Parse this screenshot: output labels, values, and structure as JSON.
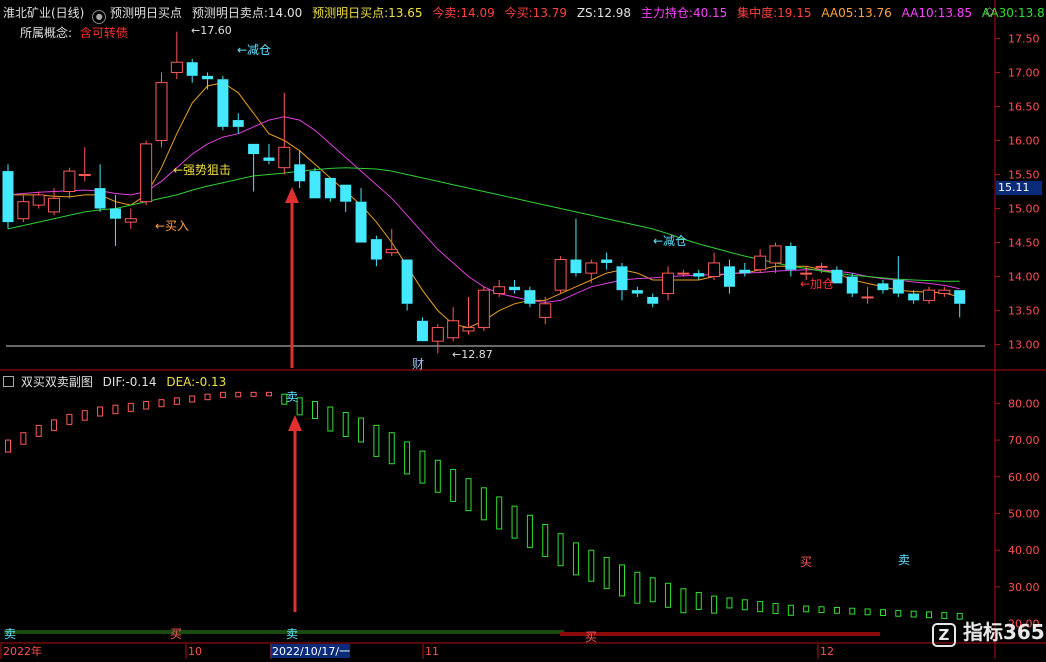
{
  "colors": {
    "up": "#ff5a5a",
    "down": "#44e8ff",
    "ma5": "#e8a020",
    "ma10": "#e040e0",
    "ma30": "#30d030",
    "frame": "#b01010",
    "axis_text": "#ff5050",
    "white": "#e0e0e0",
    "yellow": "#f0e040",
    "cyan": "#60e0ff",
    "magenta": "#ff40ff",
    "red": "#ff3030",
    "green": "#30e030",
    "orange": "#ffa040"
  },
  "header": {
    "stock": "淮北矿业(日线)",
    "indicator_icon": "gear-icon",
    "indicator": "预测明日买点",
    "sell_label": "预测明日卖点:",
    "sell_value": "14.00",
    "buy_label": "预测明日买点:",
    "buy_value": "13.65",
    "today_sell_label": "今卖:",
    "today_sell_value": "14.09",
    "today_buy_label": "今买:",
    "today_buy_value": "13.79",
    "zs_label": "ZS:",
    "zs_value": "12.98",
    "main_hold_label": "主力持仓:",
    "main_hold_value": "40.15",
    "conc_label": "集中度:",
    "conc_value": "19.15",
    "aa05_label": "AA05:",
    "aa05_value": "13.76",
    "aa10_label": "AA10:",
    "aa10_value": "13.85",
    "aa30_label": "AA30:",
    "aa30_value": "13.8",
    "concept_label": "所属概念:",
    "concept_value": "含可转债"
  },
  "sub_header": {
    "name": "双买双卖副图",
    "dif_label": "DIF:",
    "dif_value": "-0.14",
    "dea_label": "DEA:",
    "dea_value": "-0.13"
  },
  "price_label": "15.11",
  "x_labels": [
    "2022年",
    "10",
    "2022/10/17/一",
    "11",
    "12"
  ],
  "watermark": "指标365",
  "watermark_icon": "z-logo-icon",
  "chart_data": [
    {
      "type": "candlestick",
      "ylim": [
        12.7,
        17.8
      ],
      "yticks": [
        "17.50",
        "17.00",
        "16.50",
        "16.00",
        "15.50",
        "15.00",
        "14.50",
        "14.00",
        "13.50",
        "13.00"
      ],
      "ytick_values": [
        17.5,
        17.0,
        16.5,
        16.0,
        15.5,
        15.0,
        14.5,
        14.0,
        13.5,
        13.0
      ],
      "candles": [
        {
          "o": 15.55,
          "h": 15.65,
          "l": 14.7,
          "c": 14.8
        },
        {
          "o": 14.85,
          "h": 15.2,
          "l": 14.8,
          "c": 15.1
        },
        {
          "o": 15.05,
          "h": 15.25,
          "l": 15.0,
          "c": 15.2
        },
        {
          "o": 14.95,
          "h": 15.3,
          "l": 14.9,
          "c": 15.15
        },
        {
          "o": 15.25,
          "h": 15.6,
          "l": 15.15,
          "c": 15.55
        },
        {
          "o": 15.5,
          "h": 15.9,
          "l": 15.4,
          "c": 15.5
        },
        {
          "o": 15.3,
          "h": 15.65,
          "l": 14.95,
          "c": 15.0
        },
        {
          "o": 15.0,
          "h": 15.2,
          "l": 14.45,
          "c": 14.85
        },
        {
          "o": 14.8,
          "h": 15.0,
          "l": 14.7,
          "c": 14.85
        },
        {
          "o": 15.1,
          "h": 16.0,
          "l": 15.05,
          "c": 15.95
        },
        {
          "o": 16.0,
          "h": 17.0,
          "l": 15.9,
          "c": 16.85
        },
        {
          "o": 17.0,
          "h": 17.6,
          "l": 16.9,
          "c": 17.15
        },
        {
          "o": 17.15,
          "h": 17.2,
          "l": 16.85,
          "c": 16.95
        },
        {
          "o": 16.95,
          "h": 17.0,
          "l": 16.75,
          "c": 16.9
        },
        {
          "o": 16.9,
          "h": 16.95,
          "l": 16.15,
          "c": 16.2
        },
        {
          "o": 16.3,
          "h": 16.4,
          "l": 16.1,
          "c": 16.2
        },
        {
          "o": 15.95,
          "h": 15.95,
          "l": 15.25,
          "c": 15.8
        },
        {
          "o": 15.75,
          "h": 15.95,
          "l": 15.65,
          "c": 15.7
        },
        {
          "o": 15.6,
          "h": 16.7,
          "l": 15.5,
          "c": 15.9
        },
        {
          "o": 15.65,
          "h": 15.85,
          "l": 15.3,
          "c": 15.4
        },
        {
          "o": 15.55,
          "h": 15.6,
          "l": 15.15,
          "c": 15.15
        },
        {
          "o": 15.45,
          "h": 15.45,
          "l": 15.1,
          "c": 15.15
        },
        {
          "o": 15.35,
          "h": 15.35,
          "l": 14.95,
          "c": 15.1
        },
        {
          "o": 15.1,
          "h": 15.3,
          "l": 14.5,
          "c": 14.5
        },
        {
          "o": 14.55,
          "h": 14.6,
          "l": 14.15,
          "c": 14.25
        },
        {
          "o": 14.35,
          "h": 14.7,
          "l": 14.3,
          "c": 14.4
        },
        {
          "o": 14.25,
          "h": 14.25,
          "l": 13.5,
          "c": 13.6
        },
        {
          "o": 13.35,
          "h": 13.4,
          "l": 13.05,
          "c": 13.05
        },
        {
          "o": 13.05,
          "h": 13.3,
          "l": 12.87,
          "c": 13.25
        },
        {
          "o": 13.1,
          "h": 13.55,
          "l": 13.05,
          "c": 13.35
        },
        {
          "o": 13.2,
          "h": 13.7,
          "l": 13.15,
          "c": 13.25
        },
        {
          "o": 13.25,
          "h": 13.85,
          "l": 13.2,
          "c": 13.8
        },
        {
          "o": 13.75,
          "h": 13.95,
          "l": 13.7,
          "c": 13.85
        },
        {
          "o": 13.85,
          "h": 13.95,
          "l": 13.75,
          "c": 13.8
        },
        {
          "o": 13.8,
          "h": 13.85,
          "l": 13.55,
          "c": 13.6
        },
        {
          "o": 13.4,
          "h": 13.7,
          "l": 13.3,
          "c": 13.6
        },
        {
          "o": 13.8,
          "h": 14.3,
          "l": 13.75,
          "c": 14.25
        },
        {
          "o": 14.25,
          "h": 14.85,
          "l": 14.0,
          "c": 14.05
        },
        {
          "o": 14.05,
          "h": 14.25,
          "l": 13.9,
          "c": 14.2
        },
        {
          "o": 14.25,
          "h": 14.35,
          "l": 14.1,
          "c": 14.2
        },
        {
          "o": 14.15,
          "h": 14.2,
          "l": 13.65,
          "c": 13.8
        },
        {
          "o": 13.8,
          "h": 13.85,
          "l": 13.7,
          "c": 13.75
        },
        {
          "o": 13.7,
          "h": 13.75,
          "l": 13.55,
          "c": 13.6
        },
        {
          "o": 13.75,
          "h": 14.15,
          "l": 13.65,
          "c": 14.05
        },
        {
          "o": 14.05,
          "h": 14.1,
          "l": 14.0,
          "c": 14.05
        },
        {
          "o": 14.05,
          "h": 14.1,
          "l": 13.95,
          "c": 14.0
        },
        {
          "o": 14.0,
          "h": 14.35,
          "l": 13.95,
          "c": 14.2
        },
        {
          "o": 14.15,
          "h": 14.25,
          "l": 13.75,
          "c": 13.85
        },
        {
          "o": 14.1,
          "h": 14.2,
          "l": 14.0,
          "c": 14.05
        },
        {
          "o": 14.1,
          "h": 14.4,
          "l": 14.05,
          "c": 14.3
        },
        {
          "o": 14.2,
          "h": 14.5,
          "l": 14.05,
          "c": 14.45
        },
        {
          "o": 14.45,
          "h": 14.5,
          "l": 14.0,
          "c": 14.1
        },
        {
          "o": 14.05,
          "h": 14.15,
          "l": 13.95,
          "c": 14.05
        },
        {
          "o": 14.15,
          "h": 14.2,
          "l": 14.05,
          "c": 14.15
        },
        {
          "o": 14.1,
          "h": 14.15,
          "l": 13.9,
          "c": 13.9
        },
        {
          "o": 14.0,
          "h": 14.05,
          "l": 13.7,
          "c": 13.75
        },
        {
          "o": 13.7,
          "h": 13.85,
          "l": 13.6,
          "c": 13.7
        },
        {
          "o": 13.9,
          "h": 13.95,
          "l": 13.75,
          "c": 13.8
        },
        {
          "o": 13.95,
          "h": 14.3,
          "l": 13.7,
          "c": 13.75
        },
        {
          "o": 13.75,
          "h": 13.8,
          "l": 13.6,
          "c": 13.65
        },
        {
          "o": 13.65,
          "h": 13.85,
          "l": 13.6,
          "c": 13.8
        },
        {
          "o": 13.75,
          "h": 13.85,
          "l": 13.7,
          "c": 13.8
        },
        {
          "o": 13.8,
          "h": 13.8,
          "l": 13.4,
          "c": 13.6
        }
      ],
      "ma_series": [
        {
          "values": [
            15.2,
            15.2,
            15.2,
            15.18,
            15.17,
            15.2,
            15.2,
            15.1,
            15.05,
            15.2,
            15.6,
            16.1,
            16.55,
            16.8,
            16.85,
            16.7,
            16.4,
            16.1,
            16.0,
            15.85,
            15.65,
            15.45,
            15.25,
            15.05,
            14.8,
            14.5,
            14.15,
            13.8,
            13.5,
            13.3,
            13.25,
            13.35,
            13.5,
            13.6,
            13.65,
            13.65,
            13.75,
            13.85,
            13.95,
            14.05,
            14.1,
            14.05,
            13.95,
            13.95,
            13.95,
            13.95,
            14.0,
            14.05,
            14.05,
            14.1,
            14.15,
            14.15,
            14.15,
            14.1,
            14.05,
            13.95,
            13.9,
            13.85,
            13.8,
            13.78,
            13.77,
            13.76,
            13.7
          ]
        },
        {
          "values": [
            15.2,
            15.22,
            15.24,
            15.25,
            15.26,
            15.27,
            15.26,
            15.22,
            15.2,
            15.25,
            15.4,
            15.6,
            15.8,
            15.95,
            16.05,
            16.1,
            16.2,
            16.3,
            16.35,
            16.3,
            16.15,
            15.95,
            15.75,
            15.55,
            15.35,
            15.15,
            14.9,
            14.65,
            14.4,
            14.2,
            14.0,
            13.85,
            13.75,
            13.7,
            13.65,
            13.62,
            13.65,
            13.75,
            13.85,
            13.9,
            13.95,
            13.97,
            13.98,
            14.0,
            14.01,
            14.02,
            14.03,
            14.04,
            14.05,
            14.06,
            14.08,
            14.09,
            14.1,
            14.1,
            14.08,
            14.05,
            14.0,
            13.97,
            13.95,
            13.92,
            13.9,
            13.87,
            13.82
          ]
        },
        {
          "values": [
            14.7,
            14.75,
            14.8,
            14.85,
            14.9,
            14.95,
            14.98,
            15.0,
            15.05,
            15.1,
            15.15,
            15.2,
            15.27,
            15.33,
            15.38,
            15.43,
            15.48,
            15.5,
            15.52,
            15.55,
            15.57,
            15.59,
            15.6,
            15.59,
            15.58,
            15.55,
            15.5,
            15.45,
            15.4,
            15.35,
            15.3,
            15.25,
            15.2,
            15.15,
            15.1,
            15.05,
            15.0,
            14.95,
            14.9,
            14.85,
            14.8,
            14.75,
            14.7,
            14.63,
            14.55,
            14.48,
            14.42,
            14.36,
            14.3,
            14.25,
            14.2,
            14.15,
            14.12,
            14.08,
            14.05,
            14.02,
            14.0,
            13.98,
            13.96,
            13.95,
            13.94,
            13.93,
            13.93
          ]
        }
      ],
      "reference_line": 12.98,
      "annotations": {
        "high": "←17.60",
        "low": "←12.87",
        "reduce1": "←减仓",
        "reduce2": "←减仓",
        "strong": "←强势狙击",
        "buy": "←买入",
        "add": "←加仓",
        "cai": "财"
      }
    },
    {
      "type": "bar",
      "ylim": [
        15,
        85
      ],
      "yticks": [
        "80.00",
        "70.00",
        "60.00",
        "50.00",
        "40.00",
        "30.00",
        "20.00"
      ],
      "ytick_values": [
        80,
        70,
        60,
        50,
        40,
        30,
        20
      ],
      "values": [
        70,
        72,
        74,
        75.5,
        77,
        78,
        79,
        79.5,
        80,
        80.5,
        81,
        81.5,
        82,
        82.5,
        83,
        83,
        83,
        83,
        82.5,
        81.5,
        80.5,
        79,
        77.5,
        76,
        74,
        72,
        69.5,
        67,
        64.5,
        62,
        59.5,
        57,
        54.5,
        52,
        49.5,
        47,
        44.5,
        42,
        40,
        38,
        36,
        34,
        32.5,
        31,
        29.5,
        28.5,
        27.5,
        27,
        26.5,
        26,
        25.5,
        25,
        24.8,
        24.6,
        24.4,
        24.2,
        24,
        23.8,
        23.6,
        23.4,
        23.2,
        23,
        22.8
      ],
      "labels": {
        "sell1": "卖",
        "sell2": "卖",
        "sell3": "卖",
        "buy1": "买",
        "buy2": "买",
        "buy3": "买"
      }
    }
  ]
}
